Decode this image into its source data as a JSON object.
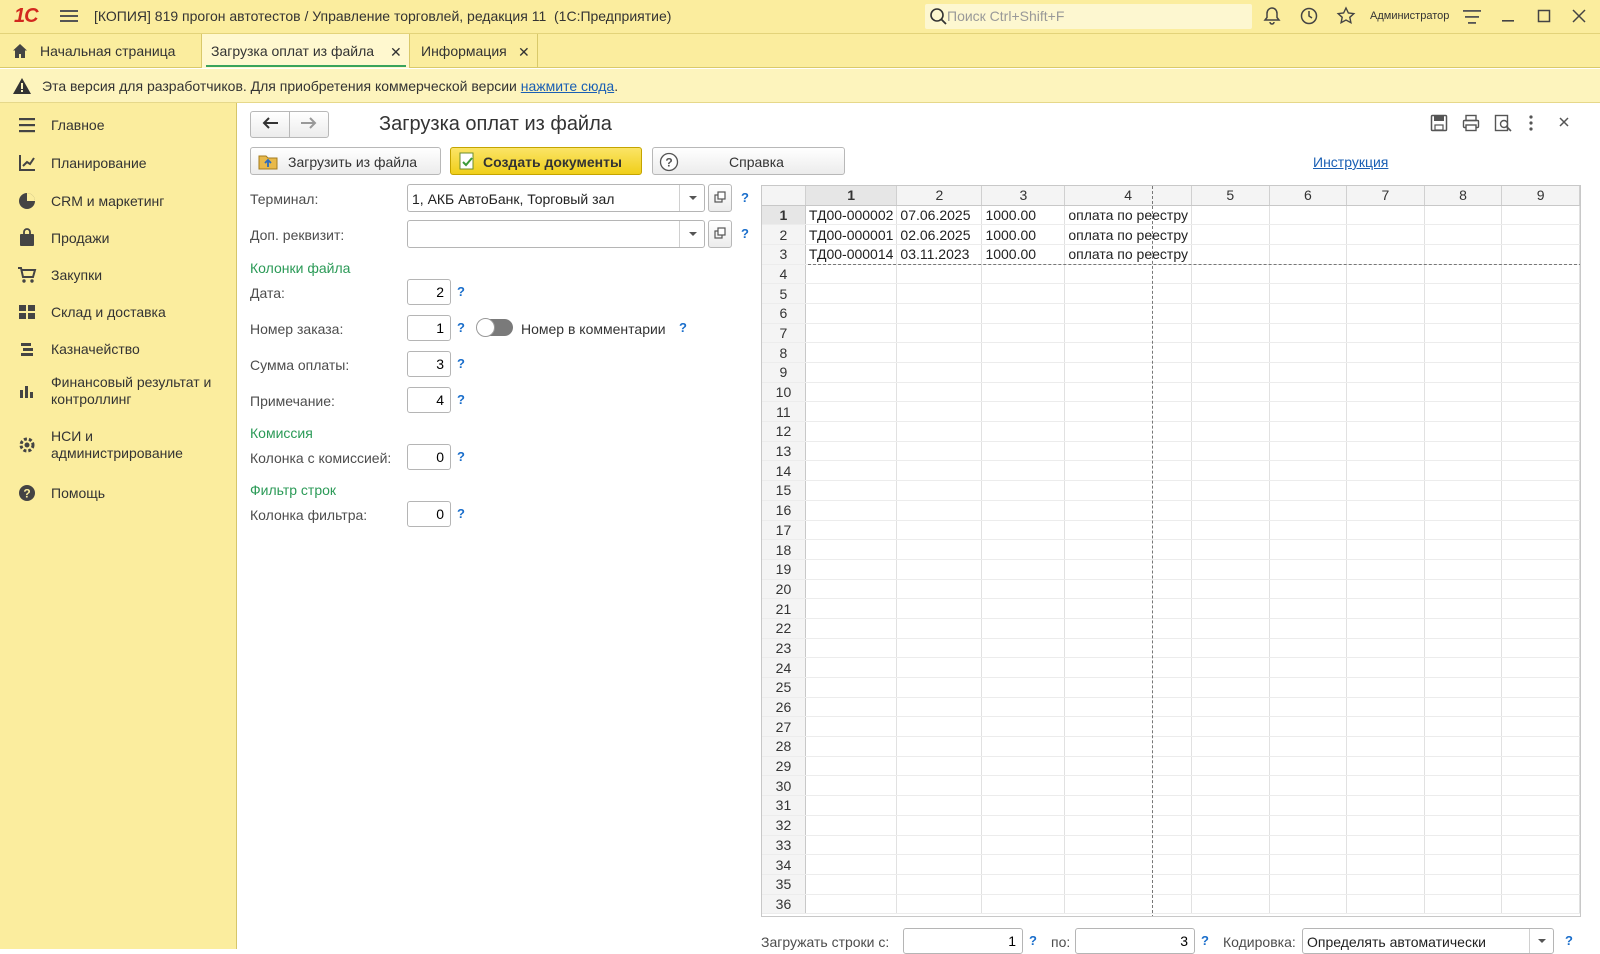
{
  "app": {
    "logo": "1С",
    "window_title": "[КОПИЯ] 819 прогон автотестов / Управление торговлей, редакция 11  (1С:Предприятие)",
    "search_placeholder": "Поиск Ctrl+Shift+F",
    "user": "Администратор"
  },
  "tabs": [
    {
      "label": "Начальная страница",
      "icon": "home-icon"
    },
    {
      "label": "Загрузка оплат из файла",
      "active": true
    },
    {
      "label": "Информация"
    }
  ],
  "dev_banner": {
    "text": "Эта версия для разработчиков. Для приобретения коммерческой версии ",
    "link": "нажмите сюда",
    "tail": "."
  },
  "sidebar": {
    "items": [
      {
        "label": "Главное",
        "icon": "menu-lines-icon"
      },
      {
        "label": "Планирование",
        "icon": "planning-chart-icon"
      },
      {
        "label": "CRM и маркетинг",
        "icon": "pie-chart-icon"
      },
      {
        "label": "Продажи",
        "icon": "shopping-bag-icon"
      },
      {
        "label": "Закупки",
        "icon": "cart-icon"
      },
      {
        "label": "Склад и доставка",
        "icon": "warehouse-grid-icon"
      },
      {
        "label": "Казначейство",
        "icon": "coins-icon"
      },
      {
        "label": "Финансовый результат и контроллинг",
        "icon": "bar-chart-icon"
      },
      {
        "label": "НСИ и администрирование",
        "icon": "gear-icon"
      },
      {
        "label": "Помощь",
        "icon": "help-circle-icon"
      }
    ]
  },
  "form": {
    "title": "Загрузка оплат из файла",
    "buttons": {
      "load": "Загрузить из файла",
      "create": "Создать документы",
      "help": "Справка",
      "instruction": "Инструкция"
    },
    "terminal_label": "Терминал:",
    "terminal_value": "1, АКБ АвтоБанк, Торговый зал",
    "extra_label": "Доп. реквизит:",
    "extra_value": "",
    "group_columns": "Колонки файла",
    "date_label": "Дата:",
    "date_value": "2",
    "order_label": "Номер заказа:",
    "order_value": "1",
    "order_toggle_label": "Номер в комментарии",
    "sum_label": "Сумма оплаты:",
    "sum_value": "3",
    "note_label": "Примечание:",
    "note_value": "4",
    "group_commission": "Комиссия",
    "commission_label": "Колонка с комиссией:",
    "commission_value": "0",
    "group_filter": "Фильтр строк",
    "filter_label": "Колонка фильтра:",
    "filter_value": "0",
    "q": "?"
  },
  "sheet": {
    "columns": [
      "1",
      "2",
      "3",
      "4",
      "5",
      "6",
      "7",
      "8",
      "9"
    ],
    "row_count": 36,
    "rows": [
      [
        "ТД00-000002",
        "07.06.2025",
        "1000.00",
        "оплата по реестру"
      ],
      [
        "ТД00-000001",
        "02.06.2025",
        "1000.00",
        "оплата по реестру"
      ],
      [
        "ТД00-000014",
        "03.11.2023",
        "1000.00",
        "оплата по реестру"
      ]
    ]
  },
  "footer": {
    "from_label": "Загружать строки с:",
    "from_value": "1",
    "to_label": "по:",
    "to_value": "3",
    "enc_label": "Кодировка:",
    "enc_value": "Определять автоматически"
  },
  "colors": {
    "accent_yellow": "#fbed9e",
    "create_button": "#f5d92b",
    "group_green": "#2b9a57",
    "link_blue": "#1a5fb4"
  }
}
